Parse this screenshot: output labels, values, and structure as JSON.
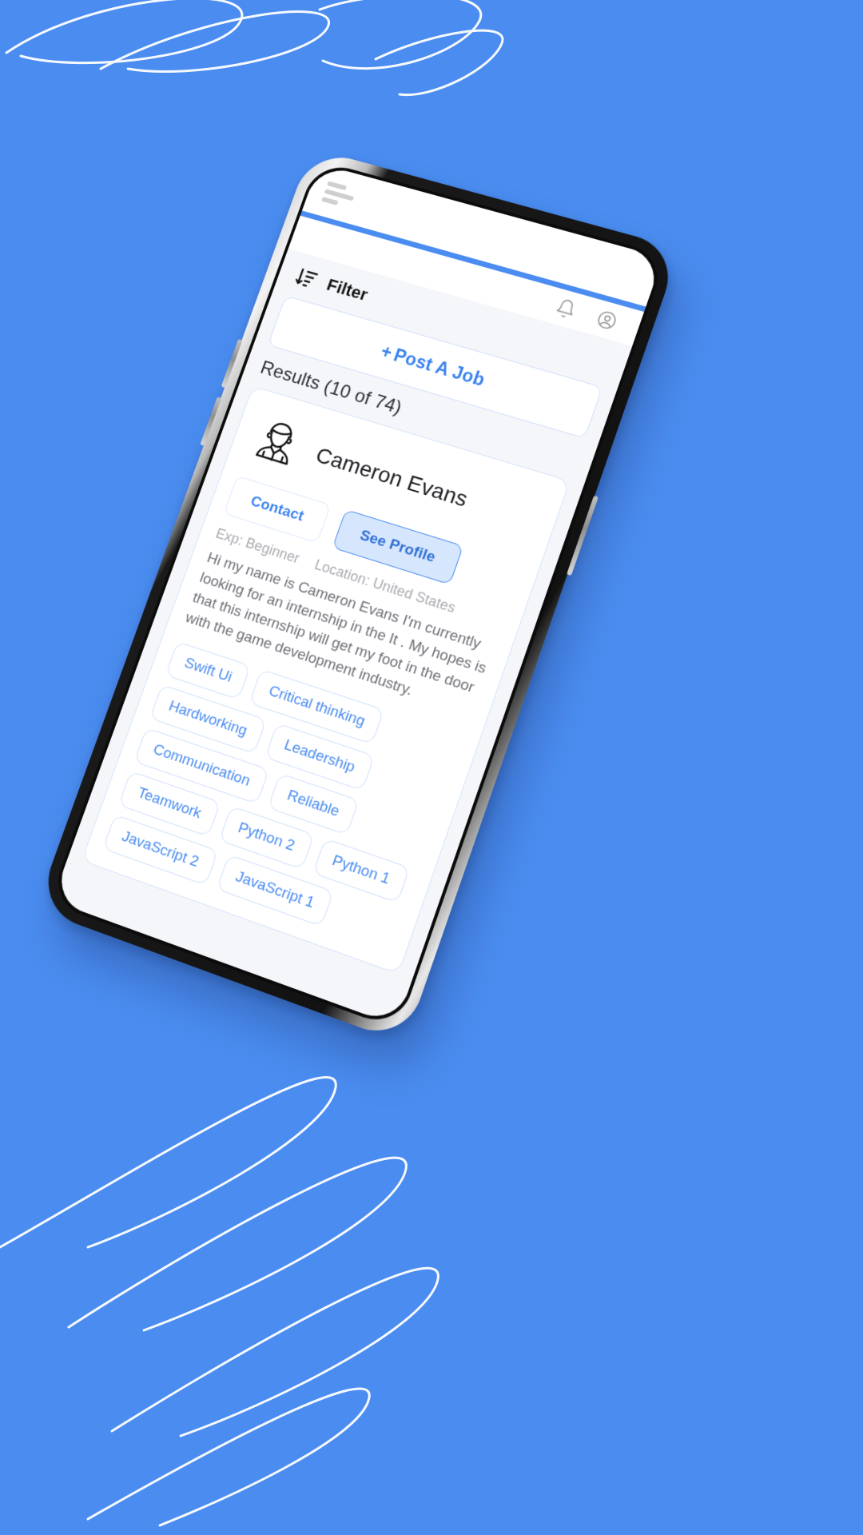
{
  "theme": {
    "background": "#4a8cf0",
    "accent": "#4a8cf0",
    "link": "#3a83f0",
    "tag_border": "#cfe0fb",
    "muted_text": "#a9a9b0"
  },
  "appbar": {
    "menu_icon": "hamburger-menu-icon",
    "notifications_icon": "bell-icon",
    "account_icon": "user-circle-icon"
  },
  "toolbar": {
    "sort_icon": "sort-descending-icon",
    "filter_label": "Filter"
  },
  "post_job": {
    "plus": "+",
    "label": "Post A Job"
  },
  "results": {
    "label": "Results (10 of 74)",
    "shown": 10,
    "total": 74
  },
  "profile_card": {
    "avatar_icon": "person-avatar-icon",
    "name": "Cameron Evans",
    "contact_label": "Contact",
    "see_profile_label": "See Profile",
    "experience": "Exp: Beginner",
    "location": "Location: United States",
    "bio": "Hi my name is Cameron Evans I'm currently looking for an internship in the It . My hopes is that this internship will get my foot in the door with the game development industry.",
    "tags": [
      "Swift Ui",
      "Critical thinking",
      "Hardworking",
      "Leadership",
      "Communication",
      "Reliable",
      "Teamwork",
      "Python 2",
      "Python 1",
      "JavaScript 2",
      "JavaScript 1"
    ]
  }
}
